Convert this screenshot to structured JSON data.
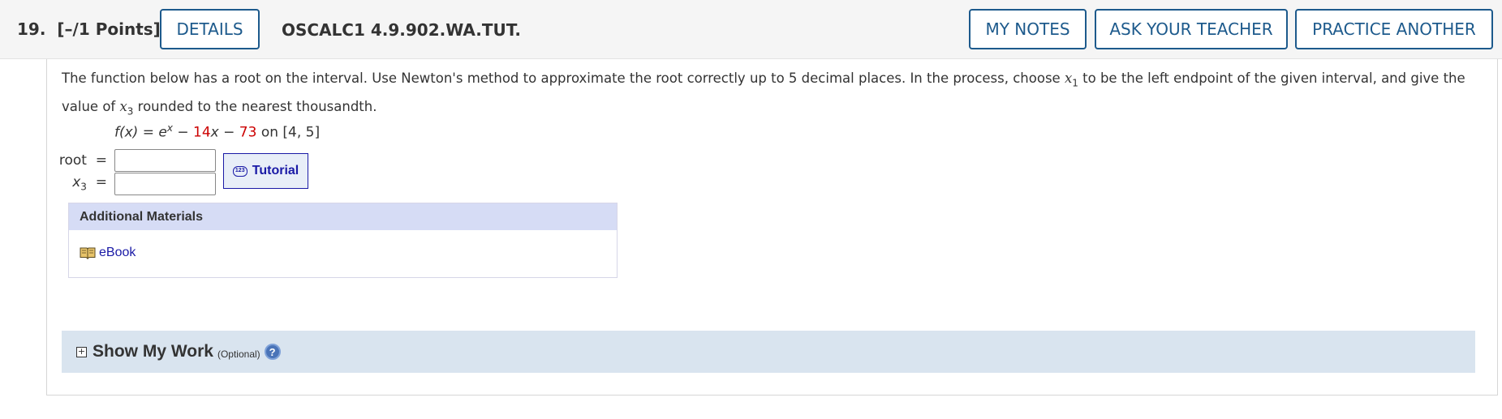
{
  "header": {
    "question_number": "19.",
    "points": "[–/1 Points]",
    "details_label": "DETAILS",
    "question_code": "OSCALC1 4.9.902.WA.TUT.",
    "my_notes_label": "MY NOTES",
    "ask_teacher_label": "ASK YOUR TEACHER",
    "practice_another_label": "PRACTICE ANOTHER"
  },
  "prompt": {
    "part1": "The function below has a root on the interval. Use Newton's method to approximate the root correctly up to 5 decimal places. In the process, choose ",
    "var1": "x",
    "var1_sub": "1",
    "part2": " to be the left endpoint of the given interval, and give the value of ",
    "var2": "x",
    "var2_sub": "3",
    "part3": " rounded to the nearest thousandth."
  },
  "formula": {
    "lhs": "f(x)",
    "equals": " = ",
    "base": "e",
    "exponent": "x",
    "minus1": " − ",
    "coef": "14",
    "x": "x",
    "minus2": " − ",
    "constant": "73",
    "interval_text": " on [4, 5]"
  },
  "answers": {
    "root_label": "root",
    "root_equals": "=",
    "root_value": "",
    "x3_var": "x",
    "x3_sub": "3",
    "x3_equals": "=",
    "x3_value": ""
  },
  "tutorial": {
    "icon_text": "123",
    "label": "Tutorial"
  },
  "materials": {
    "heading": "Additional Materials",
    "ebook_label": "eBook"
  },
  "show_work": {
    "title": "Show My Work",
    "optional": "(Optional)",
    "plus": "+",
    "help": "?"
  },
  "colors": {
    "button_border": "#1d5a8c",
    "red_numbers": "#cc0000",
    "link": "#1a1aa6",
    "materials_head": "#d6dcf5",
    "show_work_bg": "#d9e4ef"
  }
}
